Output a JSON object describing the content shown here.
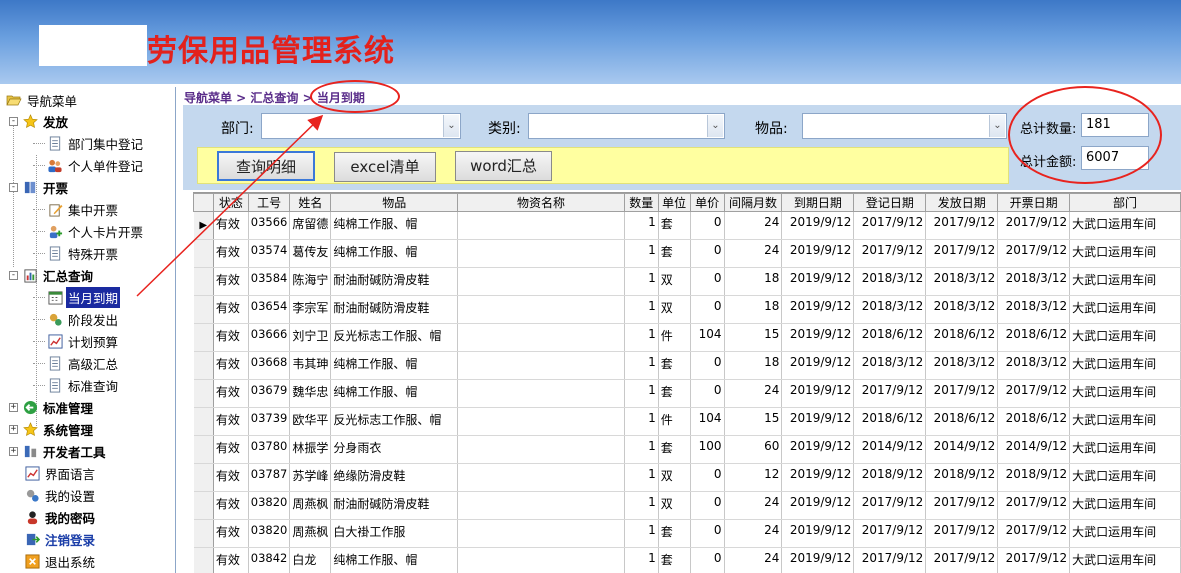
{
  "header": {
    "title": "劳保用品管理系统"
  },
  "sidebar": {
    "root": "导航菜单",
    "items": [
      {
        "label": "发放",
        "icon": "star-icon",
        "bold": true,
        "level": 1,
        "expander": "-"
      },
      {
        "label": "部门集中登记",
        "icon": "document-icon",
        "level": 2
      },
      {
        "label": "个人单件登记",
        "icon": "users-icon",
        "level": 2
      },
      {
        "label": "开票",
        "icon": "book-icon",
        "bold": true,
        "level": 1,
        "expander": "-"
      },
      {
        "label": "集中开票",
        "icon": "edit-icon",
        "level": 2
      },
      {
        "label": "个人卡片开票",
        "icon": "user-add-icon",
        "level": 2
      },
      {
        "label": "特殊开票",
        "icon": "document-icon",
        "level": 2
      },
      {
        "label": "汇总查询",
        "icon": "report-icon",
        "bold": true,
        "level": 1,
        "expander": "-"
      },
      {
        "label": "当月到期",
        "icon": "calendar-icon",
        "level": 2,
        "selected": true
      },
      {
        "label": "阶段发出",
        "icon": "gears-icon",
        "level": 2
      },
      {
        "label": "计划预算",
        "icon": "chart-icon",
        "level": 2
      },
      {
        "label": "高级汇总",
        "icon": "document-icon",
        "level": 2
      },
      {
        "label": "标准查询",
        "icon": "document-icon",
        "level": 2
      },
      {
        "label": "标准管理",
        "icon": "green-arrow-icon",
        "bold": true,
        "level": 1,
        "expander": "+"
      },
      {
        "label": "系统管理",
        "icon": "star-icon",
        "bold": true,
        "level": 1,
        "expander": "+"
      },
      {
        "label": "开发者工具",
        "icon": "tools-icon",
        "bold": true,
        "level": 1,
        "expander": "+"
      },
      {
        "label": "界面语言",
        "icon": "chart-icon",
        "level": 1
      },
      {
        "label": "我的设置",
        "icon": "settings-icon",
        "level": 1
      },
      {
        "label": "我的密码",
        "icon": "person-icon",
        "level": 1,
        "bold": true
      },
      {
        "label": "注销登录",
        "icon": "logout-icon",
        "level": 1,
        "bold": true,
        "blue": true
      },
      {
        "label": "退出系统",
        "icon": "exit-icon",
        "level": 1
      }
    ]
  },
  "breadcrumb": "导航菜单 > 汇总查询 > 当月到期",
  "filters": {
    "dept_label": "部门:",
    "category_label": "类别:",
    "item_label": "物品:",
    "dept_value": "",
    "category_value": "",
    "item_value": ""
  },
  "buttons": {
    "query_detail": "查询明细",
    "excel": "excel清单",
    "word": "word汇总"
  },
  "totals": {
    "qty_label": "总计数量:",
    "qty_value": "181",
    "amount_label": "总计金额:",
    "amount_value": "6007"
  },
  "grid": {
    "columns": [
      "状态",
      "工号",
      "姓名",
      "物品",
      "物资名称",
      "数量",
      "单位",
      "单价",
      "间隔月数",
      "到期日期",
      "登记日期",
      "发放日期",
      "开票日期",
      "部门"
    ],
    "rows": [
      [
        "有效",
        "03566",
        "席留德",
        "纯棉工作服、帽",
        "",
        "1",
        "套",
        "0",
        "24",
        "2019/9/12",
        "2017/9/12",
        "2017/9/12",
        "2017/9/12",
        "大武口运用车间"
      ],
      [
        "有效",
        "03574",
        "葛传友",
        "纯棉工作服、帽",
        "",
        "1",
        "套",
        "0",
        "24",
        "2019/9/12",
        "2017/9/12",
        "2017/9/12",
        "2017/9/12",
        "大武口运用车间"
      ],
      [
        "有效",
        "03584",
        "陈海宁",
        "耐油耐碱防滑皮鞋",
        "",
        "1",
        "双",
        "0",
        "18",
        "2019/9/12",
        "2018/3/12",
        "2018/3/12",
        "2018/3/12",
        "大武口运用车间"
      ],
      [
        "有效",
        "03654",
        "李宗军",
        "耐油耐碱防滑皮鞋",
        "",
        "1",
        "双",
        "0",
        "18",
        "2019/9/12",
        "2018/3/12",
        "2018/3/12",
        "2018/3/12",
        "大武口运用车间"
      ],
      [
        "有效",
        "03666",
        "刘宁卫",
        "反光标志工作服、帽",
        "",
        "1",
        "件",
        "104",
        "15",
        "2019/9/12",
        "2018/6/12",
        "2018/6/12",
        "2018/6/12",
        "大武口运用车间"
      ],
      [
        "有效",
        "03668",
        "韦其珅",
        "纯棉工作服、帽",
        "",
        "1",
        "套",
        "0",
        "18",
        "2019/9/12",
        "2018/3/12",
        "2018/3/12",
        "2018/3/12",
        "大武口运用车间"
      ],
      [
        "有效",
        "03679",
        "魏华忠",
        "纯棉工作服、帽",
        "",
        "1",
        "套",
        "0",
        "24",
        "2019/9/12",
        "2017/9/12",
        "2017/9/12",
        "2017/9/12",
        "大武口运用车间"
      ],
      [
        "有效",
        "03739",
        "欧华平",
        "反光标志工作服、帽",
        "",
        "1",
        "件",
        "104",
        "15",
        "2019/9/12",
        "2018/6/12",
        "2018/6/12",
        "2018/6/12",
        "大武口运用车间"
      ],
      [
        "有效",
        "03780",
        "林振学",
        "分身雨衣",
        "",
        "1",
        "套",
        "100",
        "60",
        "2019/9/12",
        "2014/9/12",
        "2014/9/12",
        "2014/9/12",
        "大武口运用车间"
      ],
      [
        "有效",
        "03787",
        "苏学峰",
        "绝缘防滑皮鞋",
        "",
        "1",
        "双",
        "0",
        "12",
        "2019/9/12",
        "2018/9/12",
        "2018/9/12",
        "2018/9/12",
        "大武口运用车间"
      ],
      [
        "有效",
        "03820",
        "周燕枫",
        "耐油耐碱防滑皮鞋",
        "",
        "1",
        "双",
        "0",
        "24",
        "2019/9/12",
        "2017/9/12",
        "2017/9/12",
        "2017/9/12",
        "大武口运用车间"
      ],
      [
        "有效",
        "03820",
        "周燕枫",
        "白大褂工作服",
        "",
        "1",
        "套",
        "0",
        "24",
        "2019/9/12",
        "2017/9/12",
        "2017/9/12",
        "2017/9/12",
        "大武口运用车间"
      ],
      [
        "有效",
        "03842",
        "白龙",
        "纯棉工作服、帽",
        "",
        "1",
        "套",
        "0",
        "24",
        "2019/9/12",
        "2017/9/12",
        "2017/9/12",
        "2017/9/12",
        "大武口运用车间"
      ]
    ]
  },
  "colors": {
    "accent_red": "#e3211c",
    "header_blue": "#3d78c7",
    "panel_blue": "#c4d8ee",
    "button_bar_yellow": "#ffffa0",
    "selected_navy": "#1a2aa0"
  }
}
